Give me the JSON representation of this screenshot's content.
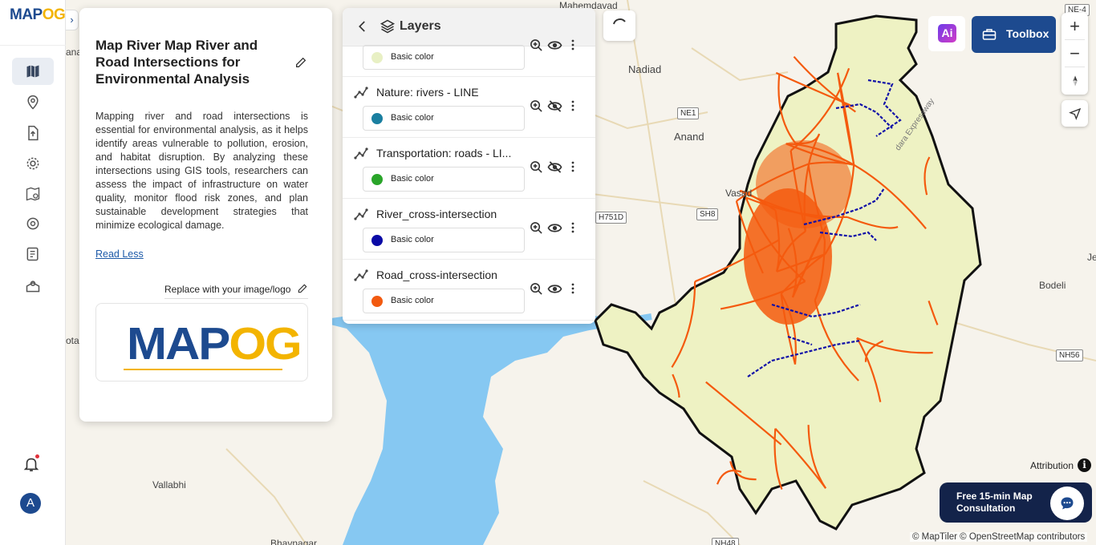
{
  "app": {
    "logo_main": "MAP",
    "logo_accent": "OG",
    "rail_toggle": "›"
  },
  "rail": {
    "items": [
      {
        "name": "map-icon",
        "active": true
      },
      {
        "name": "location-pin-icon",
        "active": false
      },
      {
        "name": "upload-icon",
        "active": false
      },
      {
        "name": "gear-icon",
        "active": false
      },
      {
        "name": "map-settings-icon",
        "active": false
      },
      {
        "name": "cog-badge-icon",
        "active": false
      },
      {
        "name": "report-icon",
        "active": false
      },
      {
        "name": "map-pin-box-icon",
        "active": false
      }
    ],
    "avatar_initial": "A"
  },
  "info_panel": {
    "title": "Map River Map River and Road Intersections for Environmental Analysis",
    "description": "Mapping river and road intersections is essential for environmental analysis, as it helps identify areas vulnerable to pollution, erosion, and habitat disruption. By analyzing these intersections using GIS tools, researchers can assess the impact of infrastructure on water quality, monitor flood risk zones, and plan sustainable development strategies that minimize ecological damage.",
    "read_less": "Read Less",
    "replace_logo_label": "Replace with your image/logo",
    "logo_main": "MAP",
    "logo_accent": "OG"
  },
  "layers_panel": {
    "title": "Layers",
    "layers": [
      {
        "name": "",
        "color_label": "Basic color",
        "color": "#e8f0c4",
        "visible": true
      },
      {
        "name": "Nature: rivers - LINE",
        "color_label": "Basic color",
        "color": "#1a7fa0",
        "visible": false
      },
      {
        "name": "Transportation: roads - LI...",
        "color_label": "Basic color",
        "color": "#2aa52a",
        "visible": false
      },
      {
        "name": "River_cross-intersection",
        "color_label": "Basic color",
        "color": "#0a0aa6",
        "visible": true
      },
      {
        "name": "Road_cross-intersection",
        "color_label": "Basic color",
        "color": "#f25a10",
        "visible": true
      }
    ]
  },
  "toolbar": {
    "ai_label": "Ai",
    "toolbox_label": "Toolbox",
    "zoom_in": "+",
    "zoom_out": "−"
  },
  "map": {
    "labels": {
      "nadiad": "Nadiad",
      "anand": "Anand",
      "vasad": "Vasad",
      "bodeli": "Bodeli",
      "vallabhi": "Vallabhi",
      "bhavnagar": "Bhavnagar",
      "mahemdavad": "Mahemdavad",
      "expressway": "dara Expressway",
      "left_ana": "ana",
      "left_otad": "otad",
      "right_je": "Je"
    },
    "shields": {
      "ne4": "NE-4",
      "ne1": "NE1",
      "sh8": "SH8",
      "nh751d": "H751D",
      "nh56": "NH56",
      "nh48": "NH48"
    },
    "colors": {
      "district_fill": "#eef2c3",
      "roads": "#f45a0e",
      "rivers": "#1010a8",
      "water": "#86c8f2",
      "land": "#f6f3ec"
    }
  },
  "footer": {
    "attribution": "Attribution",
    "info_glyph": "i",
    "consult_text": "Free 15-min Map Consultation",
    "copyright": "© MapTiler © OpenStreetMap contributors"
  }
}
